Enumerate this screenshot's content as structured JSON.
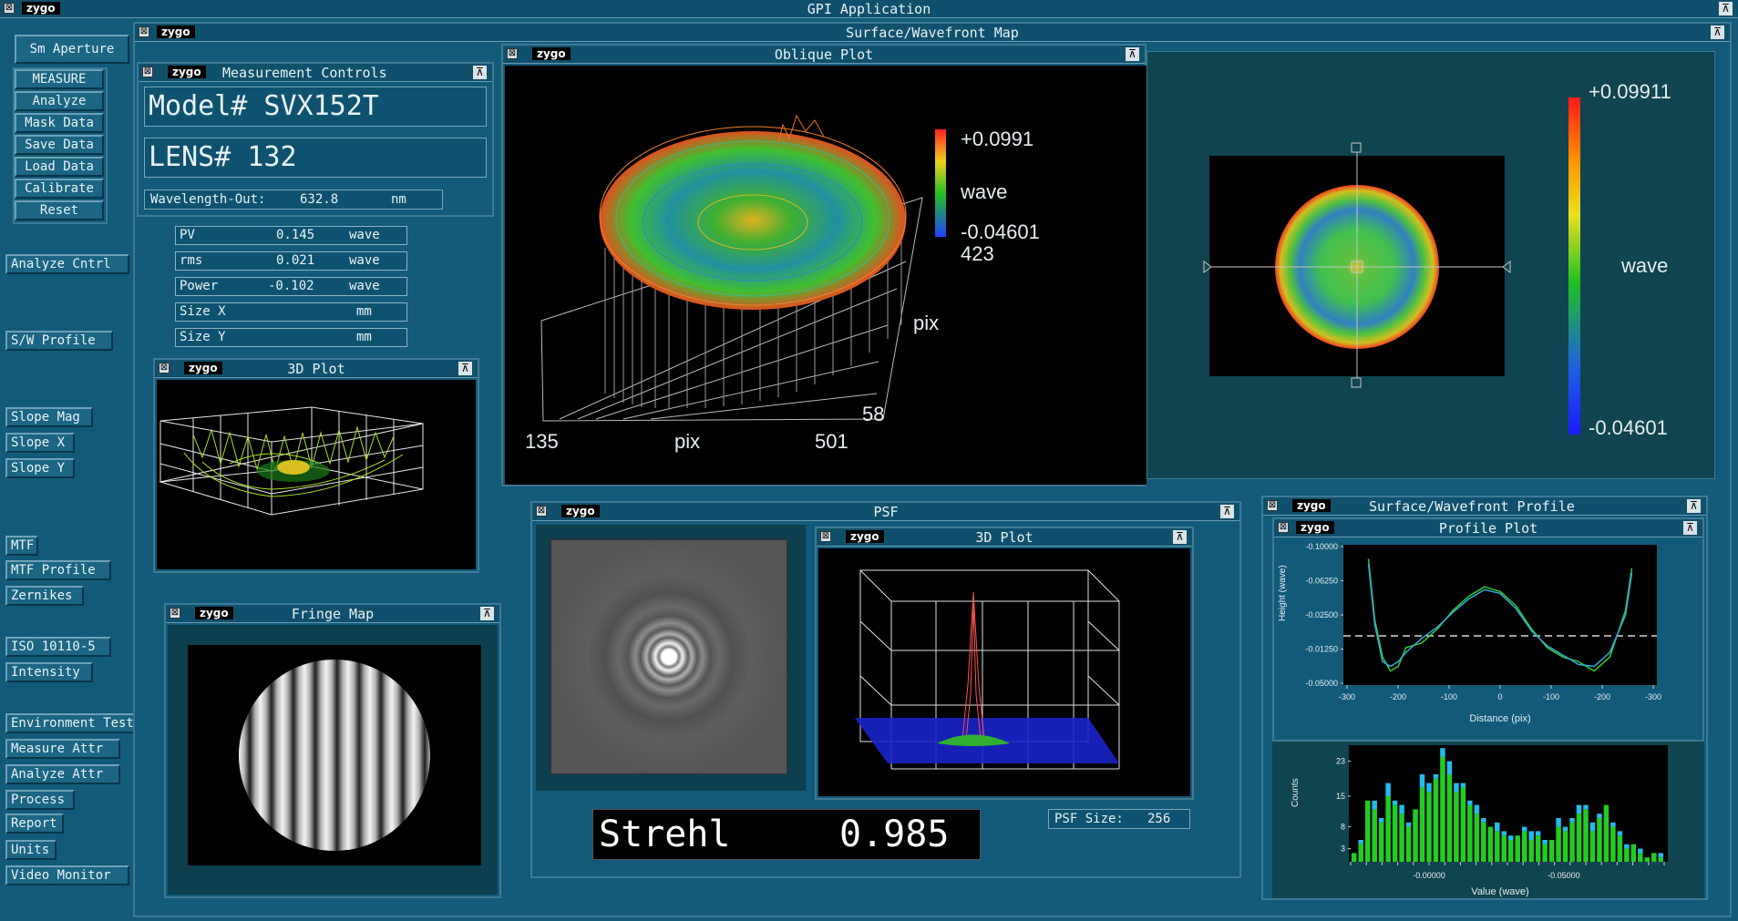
{
  "app": {
    "logo": "zygo",
    "title": "GPI Application",
    "close_glyph": "⊠",
    "minimize_glyph": "⊼",
    "accent_color": "#135a78"
  },
  "sidebar": {
    "aperture": "Sm Aperture",
    "group_buttons": [
      "MEASURE",
      "Analyze",
      "Mask Data",
      "Save Data",
      "Load Data",
      "Calibrate",
      "Reset"
    ],
    "items": [
      "Analyze Cntrl",
      "S/W Profile",
      "Slope Mag",
      "Slope X",
      "Slope Y",
      "MTF",
      "MTF Profile",
      "Zernikes",
      "ISO 10110-5",
      "Intensity",
      "Environment Test",
      "Measure Attr",
      "Analyze Attr",
      "Process",
      "Report",
      "Units",
      "Video Monitor"
    ]
  },
  "surface_window": {
    "title": "Surface/Wavefront Map"
  },
  "measurement_controls": {
    "title": "Measurement Controls",
    "model": "Model# SVX152T",
    "lens": "LENS# 132",
    "wavelength_label": "Wavelength-Out:",
    "wavelength_value": "632.8",
    "wavelength_unit": "nm"
  },
  "stats": [
    {
      "label": "PV",
      "value": "0.145",
      "unit": "wave"
    },
    {
      "label": "rms",
      "value": "0.021",
      "unit": "wave"
    },
    {
      "label": "Power",
      "value": "-0.102",
      "unit": "wave"
    },
    {
      "label": "Size X",
      "value": "",
      "unit": "mm"
    },
    {
      "label": "Size Y",
      "value": "",
      "unit": "mm"
    }
  ],
  "plot3d_small": {
    "title": "3D Plot"
  },
  "oblique_plot": {
    "title": "Oblique Plot",
    "scale_max": "+0.0991",
    "scale_unit": "wave",
    "scale_min": "-0.04601",
    "scale_count": "423",
    "x_min": "135",
    "x_label": "pix",
    "x_max": "501",
    "y_label": "pix",
    "y_min": "58"
  },
  "surface_map": {
    "scale_max": "+0.09911",
    "scale_unit": "wave",
    "scale_min": "-0.04601"
  },
  "fringe_map": {
    "title": "Fringe Map"
  },
  "psf": {
    "title": "PSF",
    "plot_title": "3D Plot",
    "strehl_label": "Strehl",
    "strehl_value": "0.985",
    "psf_size_label": "PSF Size:",
    "psf_size_value": "256"
  },
  "profile_window": {
    "title": "Surface/Wavefront Profile",
    "plot_title": "Profile Plot"
  },
  "chart_data": [
    {
      "type": "line",
      "title": "Profile Plot",
      "xlabel": "Distance (pix)",
      "ylabel": "Height (wave)",
      "x_tick_labels": [
        "-300",
        "-200",
        "-100",
        "0",
        "-100",
        "-200",
        "-300"
      ],
      "y_tick_labels": [
        "-0.10000",
        "-0.06250",
        "-0.02500",
        "-0.01250",
        "-0.05000"
      ],
      "ylim": [
        -0.05,
        0.1
      ],
      "grid": false,
      "series": [
        {
          "color": "#33cc33",
          "x": [
            -168,
            -160,
            -150,
            -140,
            -130,
            -120,
            -100,
            -80,
            -60,
            -40,
            -20,
            0,
            20,
            40,
            60,
            80,
            100,
            120,
            140,
            160,
            168
          ],
          "y": [
            0.085,
            0.02,
            -0.02,
            -0.035,
            -0.03,
            -0.01,
            -0.005,
            0.01,
            0.03,
            0.045,
            0.055,
            0.05,
            0.035,
            0.01,
            -0.01,
            -0.02,
            -0.025,
            -0.035,
            -0.02,
            0.03,
            0.075
          ]
        },
        {
          "color": "#33aadd",
          "x": [
            -168,
            -160,
            -150,
            -140,
            -130,
            -120,
            -100,
            -80,
            -60,
            -40,
            -20,
            0,
            20,
            40,
            60,
            80,
            100,
            120,
            140,
            160,
            168
          ],
          "y": [
            0.08,
            0.015,
            -0.025,
            -0.03,
            -0.025,
            -0.015,
            0.0,
            0.012,
            0.028,
            0.042,
            0.052,
            0.048,
            0.032,
            0.008,
            -0.008,
            -0.018,
            -0.028,
            -0.03,
            -0.015,
            0.025,
            0.07
          ]
        }
      ]
    },
    {
      "type": "bar",
      "title": "",
      "xlabel": "Value (wave)",
      "ylabel": "Counts",
      "x_tick_labels": [
        "-0.00000",
        "-0.05000"
      ],
      "y_tick_labels": [
        "23",
        "15",
        "8",
        "3"
      ],
      "ylim": [
        0,
        25
      ],
      "series": [
        {
          "color": "#22cc22",
          "values": [
            2,
            4,
            14,
            12,
            9,
            15,
            13,
            11,
            8,
            12,
            17,
            16,
            19,
            24,
            20,
            16,
            17,
            13,
            11,
            9,
            8,
            7,
            6,
            5,
            6,
            7,
            5,
            6,
            4,
            5,
            8,
            7,
            9,
            11,
            12,
            7,
            10,
            13,
            8,
            6,
            3,
            4,
            2,
            1,
            2,
            1
          ]
        },
        {
          "color": "#22bbee",
          "values": [
            0,
            1,
            0,
            2,
            1,
            3,
            1,
            2,
            1,
            0,
            3,
            2,
            1,
            2,
            3,
            2,
            1,
            1,
            2,
            1,
            0,
            2,
            1,
            1,
            0,
            1,
            2,
            1,
            1,
            0,
            2,
            1,
            1,
            2,
            1,
            2,
            1,
            0,
            1,
            1,
            1,
            0,
            1,
            0,
            0,
            1
          ]
        }
      ]
    }
  ]
}
